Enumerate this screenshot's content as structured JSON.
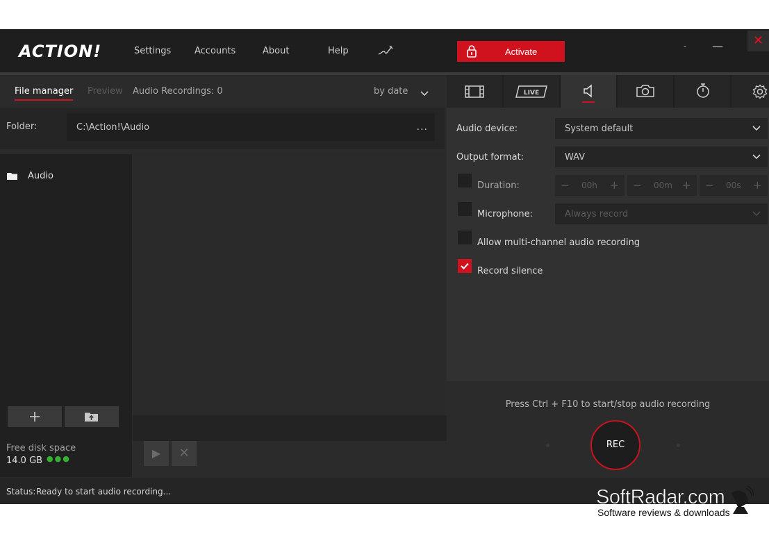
{
  "app": {
    "logo_text": "ACTION!",
    "menu": [
      "Settings",
      "Accounts",
      "About",
      "Help"
    ],
    "activate_label": "Activate",
    "window": {
      "minimize_small": "-",
      "minimize": "—",
      "close": "✕"
    }
  },
  "left": {
    "tabs": {
      "file_manager": "File manager",
      "preview": "Preview",
      "recordings_info": "Audio Recordings: 0"
    },
    "sort_label": "by date",
    "folder_label": "Folder:",
    "folder_path": "C:\\Action!\\Audio",
    "folder_browse": "...",
    "tree": [
      {
        "label": "Audio",
        "icon": "folder-icon"
      }
    ],
    "disk": {
      "label": "Free disk space",
      "value": "14.0 GB",
      "level_indicator": "●●●"
    }
  },
  "right": {
    "modes": [
      "video-mode",
      "live-mode",
      "audio-mode",
      "screenshot-mode",
      "timer-mode",
      "settings"
    ],
    "active_mode": "audio-mode",
    "audio_device": {
      "label": "Audio device:",
      "value": "System default"
    },
    "output_format": {
      "label": "Output format:",
      "value": "WAV"
    },
    "duration": {
      "label": "Duration:",
      "hours": "00h",
      "minutes": "00m",
      "seconds": "00s",
      "checked": false
    },
    "microphone": {
      "label": "Microphone:",
      "value": "Always record",
      "checked": false
    },
    "multichannel": {
      "label": "Allow multi-channel audio recording",
      "checked": false
    },
    "record_silence": {
      "label": "Record silence",
      "checked": true
    },
    "hint": "Press Ctrl + F10 to start/stop audio recording",
    "rec_label": "REC"
  },
  "status": {
    "key": "Status:",
    "value": "Ready to start audio recording..."
  },
  "watermark": {
    "brand": "SoftRadar.com",
    "tagline": "Software reviews & downloads"
  },
  "colors": {
    "accent": "#d0121f",
    "background": "#2b2b2b",
    "disk_ok": "#32b432"
  }
}
